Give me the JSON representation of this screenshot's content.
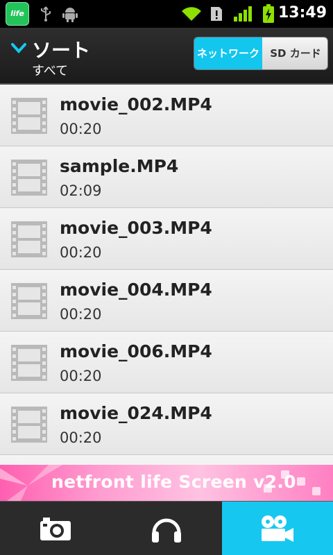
{
  "status_bar": {
    "time": "13:49",
    "app_icon_text": "life",
    "icons": [
      "netfront-life-app-icon",
      "usb-icon",
      "android-icon",
      "wifi-icon",
      "alert-icon",
      "signal-icon",
      "battery-charging-icon"
    ]
  },
  "header": {
    "sort_label": "ソート",
    "sort_sub": "すべて",
    "tabs": [
      {
        "label": "ネットワーク",
        "active": true
      },
      {
        "label": "SD カード",
        "active": false
      }
    ]
  },
  "files": [
    {
      "name": "movie_002.MP4",
      "duration": "00:20"
    },
    {
      "name": "sample.MP4",
      "duration": "02:09"
    },
    {
      "name": "movie_003.MP4",
      "duration": "00:20"
    },
    {
      "name": "movie_004.MP4",
      "duration": "00:20"
    },
    {
      "name": "movie_006.MP4",
      "duration": "00:20"
    },
    {
      "name": "movie_024.MP4",
      "duration": "00:20"
    }
  ],
  "banner": {
    "text": "netfront life Screen v2.0"
  },
  "bottom_tabs": [
    {
      "name": "camera-icon",
      "active": false
    },
    {
      "name": "headphones-icon",
      "active": false
    },
    {
      "name": "movie-camera-icon",
      "active": true
    }
  ],
  "colors": {
    "accent": "#16c8f0",
    "banner": "#ff7fc2",
    "header": "#222222"
  }
}
